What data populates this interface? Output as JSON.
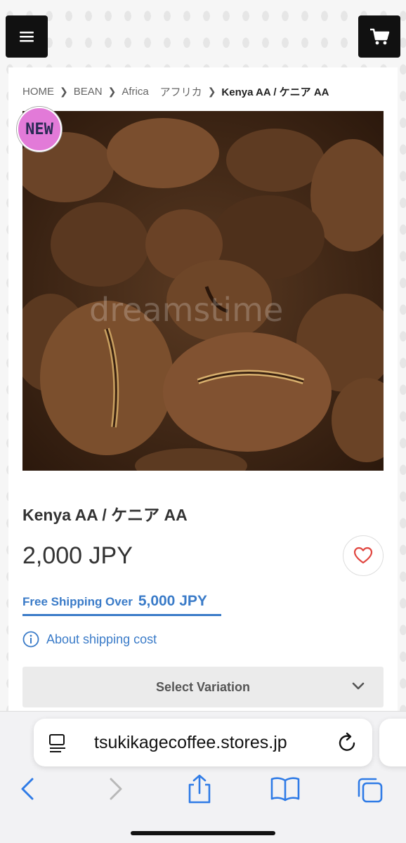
{
  "header": {
    "menu_icon": "hamburger-icon",
    "cart_icon": "cart-icon"
  },
  "breadcrumb": {
    "items": [
      "HOME",
      "BEAN",
      "Africa",
      "アフリカ"
    ],
    "current": "Kenya AA / ケニア AA"
  },
  "product": {
    "badge": "NEW",
    "image_watermark": "dreamstime",
    "name": "Kenya AA / ケニア AA",
    "price": "2,000 JPY",
    "favorite_icon": "heart-icon"
  },
  "shipping": {
    "free_label": "Free Shipping Over",
    "free_amount": "5,000 JPY",
    "about_label": "About shipping cost"
  },
  "variation": {
    "label": "Select Variation"
  },
  "browser": {
    "url": "tsukikagecoffee.stores.jp"
  },
  "colors": {
    "accent": "#3a7bc8",
    "heart": "#e0453f",
    "badge": "#e27ad8",
    "ios_blue": "#2f7be6"
  }
}
